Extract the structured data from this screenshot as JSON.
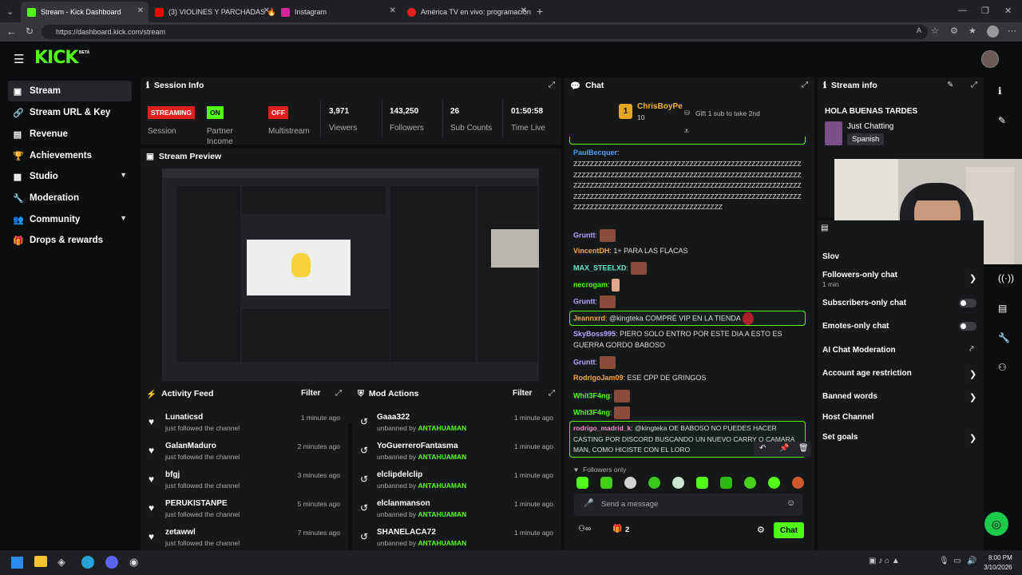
{
  "browser": {
    "tabs": [
      {
        "title": "Stream - Kick Dashboard",
        "active": true,
        "favicon_color": "#53fc18"
      },
      {
        "title": "(3) VIOLINES Y PARCHADAS 🔥 KIN",
        "active": false,
        "favicon_color": "#ff0000"
      },
      {
        "title": "Instagram",
        "active": false,
        "favicon_color": "#d6249f"
      },
      {
        "title": "América TV en vivo: programación",
        "active": false,
        "favicon_color": "#e02020"
      }
    ],
    "url": "https://dashboard.kick.com/stream"
  },
  "brand": {
    "logo": "KICK",
    "beta": "BETA",
    "accent": "#53fc18"
  },
  "sidebar": {
    "items": [
      {
        "label": "Stream",
        "icon": "stream-icon",
        "active": true
      },
      {
        "label": "Stream URL & Key",
        "icon": "link-icon"
      },
      {
        "label": "Revenue",
        "icon": "revenue-icon"
      },
      {
        "label": "Achievements",
        "icon": "trophy-icon"
      },
      {
        "label": "Studio",
        "icon": "studio-icon",
        "chevron": true
      },
      {
        "label": "Moderation",
        "icon": "wrench-icon"
      },
      {
        "label": "Community",
        "icon": "community-icon",
        "chevron": true
      },
      {
        "label": "Drops & rewards",
        "icon": "drops-icon"
      }
    ]
  },
  "session": {
    "title": "Session Info",
    "streaming": "STREAMING",
    "session_label": "Session",
    "partner_on": "ON",
    "partner_label1": "Partner",
    "partner_label2": "Income",
    "multi_off": "OFF",
    "multi_label": "Multistream",
    "viewers": "3,971",
    "viewers_label": "Viewers",
    "followers": "143,250",
    "followers_label": "Followers",
    "subs": "26",
    "subs_label": "Sub Counts",
    "time": "01:50:58",
    "time_label": "Time Live"
  },
  "preview": {
    "title": "Stream Preview"
  },
  "activity": {
    "title": "Activity Feed",
    "filter": "Filter",
    "items": [
      {
        "name": "Lunaticsd",
        "sub": "just followed the channel",
        "time": "1 minute ago"
      },
      {
        "name": "GalanMaduro",
        "sub": "just followed the channel",
        "time": "2 minutes ago"
      },
      {
        "name": "bfgj",
        "sub": "just followed the channel",
        "time": "3 minutes ago"
      },
      {
        "name": "PERUKISTANPE",
        "sub": "just followed the channel",
        "time": "5 minutes ago"
      },
      {
        "name": "zetawwl",
        "sub": "just followed the channel",
        "time": "7 minutes ago"
      }
    ]
  },
  "modactions": {
    "title": "Mod Actions",
    "filter": "Filter",
    "items": [
      {
        "name": "Gaaa322",
        "pre": "unbanned by ",
        "by": "ANTAHUAMAN",
        "time": "1 minute ago"
      },
      {
        "name": "YoGuerreroFantasma",
        "pre": "unbanned by ",
        "by": "ANTAHUAMAN",
        "time": "1 minute ago"
      },
      {
        "name": "elclipdelclip",
        "pre": "unbanned by ",
        "by": "ANTAHUAMAN",
        "time": "1 minute ago"
      },
      {
        "name": "elclanmanson",
        "pre": "unbanned by ",
        "by": "ANTAHUAMAN",
        "time": "1 minute ago"
      },
      {
        "name": "SHANELACA72",
        "pre": "unbanned by ",
        "by": "ANTAHUAMAN",
        "time": "1 minute ago"
      }
    ]
  },
  "chat": {
    "title": "Chat",
    "pinned_user": "ChrisBoyPe",
    "pinned_rank": "1",
    "pinned_count": "10",
    "gift_text": "Gift 1 sub to take 2nd",
    "messages": {
      "m1_user": "PaulBecquer",
      "m1_text": "ZZZZZZZZZZZZZZZZZZZZZZZZZZZZZZZZZZZZZZZZZZZZZZZZZZZZZZZZZZZZZZZZZZZZZZZZZZZZZZZZZZZZZZZZZZZZZZZZZZZZZZZZZZZZZZZZZZZZZZZZZZZZZZZZZZZZZZZZZZZZZZZZZZZZZZZZZZZZZZZZZZZZZZZZZZZZZZZZZZZZZZZZZZZZZZZZZZZZZZZZZZZZZZZZZZZZZZZZZZZZZZZZZZZZZZZZZZZZZZZZZZZZZZZZZZZZZZZZ",
      "m2_user": "Gruntt",
      "m3_user": "VincentDH",
      "m3_text": "1+ PARA LAS FLACAS",
      "m4_user": "MAX_STEELXD",
      "m5_user": "necrogam",
      "m6_user": "Gruntt",
      "m7_user": "Jeannxrd",
      "m7_text": "@kingteka COMPRÉ VIP EN LA TIENDA",
      "m8_user": "SkyBoss995",
      "m8_text": "PIERO SOLO ENTRO POR ESTE DIA A ESTO ES GUERRA GORDO BABOSO",
      "m9_user": "Gruntt",
      "m10_user": "RodrigoJam09",
      "m10_text": "ESE CPP DE GRINGOS",
      "m11_user": "Whit3F4ng",
      "m12_user": "Whit3F4ng",
      "m13_user": "rodrigo_madrid_k",
      "m13_text": "@kingteka OE BABOSO NO PUEDES HACER CASTING POR DISCORD BUSCANDO UN NUEVO CARRY O CAMARA MAN, COMO HICISTE CON EL LORO"
    },
    "followers_only": "Followers only",
    "placeholder": "Send a message",
    "people_count": "2",
    "chat_button": "Chat"
  },
  "streaminfo": {
    "title": "Stream info",
    "stream_title": "HOLA BUENAS TARDES",
    "category": "Just Chatting",
    "language": "Spanish"
  },
  "chatsettings": {
    "slow_partial": "Slov",
    "followers_only": "Followers-only chat",
    "followers_only_value": "1 min",
    "subscribers_only": "Subscribers-only chat",
    "emotes_only": "Emotes-only chat",
    "ai_mod": "AI Chat Moderation",
    "age_restriction": "Account age restriction",
    "banned_words": "Banned words",
    "host_channel": "Host Channel",
    "set_goals": "Set goals"
  },
  "taskbar": {
    "time": "8:00 PM",
    "date": "3/10/2026"
  }
}
